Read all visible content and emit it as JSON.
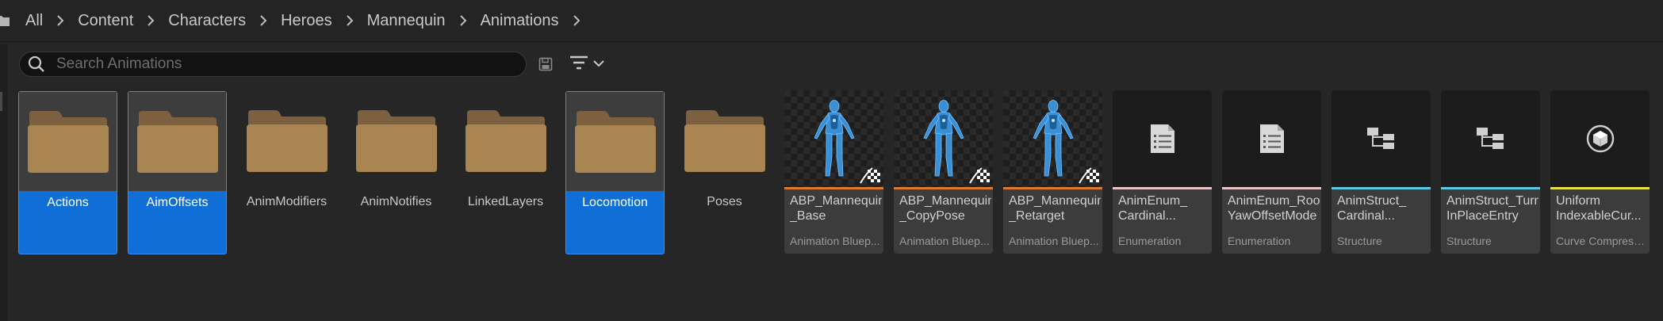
{
  "breadcrumb": {
    "items": [
      "All",
      "Content",
      "Characters",
      "Heroes",
      "Mannequin",
      "Animations"
    ]
  },
  "search": {
    "placeholder": "Search Animations",
    "value": ""
  },
  "folders": [
    {
      "label": "Actions",
      "selected": true
    },
    {
      "label": "AimOffsets",
      "selected": true
    },
    {
      "label": "AnimModifiers",
      "selected": false
    },
    {
      "label": "AnimNotifies",
      "selected": false
    },
    {
      "label": "LinkedLayers",
      "selected": false
    },
    {
      "label": "Locomotion",
      "selected": true
    },
    {
      "label": "Poses",
      "selected": false
    }
  ],
  "assets": [
    {
      "name": "ABP_Mannequin\n_Base",
      "type": "Animation Bluep...",
      "icon": "mannequin-thumbnail",
      "color": "#e07a2b"
    },
    {
      "name": "ABP_Mannequin\n_CopyPose",
      "type": "Animation Bluep...",
      "icon": "mannequin-thumbnail",
      "color": "#e07a2b"
    },
    {
      "name": "ABP_Mannequin\n_Retarget",
      "type": "Animation Bluep...",
      "icon": "mannequin-thumbnail",
      "color": "#e07a2b"
    },
    {
      "name": "AnimEnum_\nCardinal...",
      "type": "Enumeration",
      "icon": "enumeration-icon",
      "color": "#e8c4c8"
    },
    {
      "name": "AnimEnum_Root\nYawOffsetMode",
      "type": "Enumeration",
      "icon": "enumeration-icon",
      "color": "#e8c4c8"
    },
    {
      "name": "AnimStruct_\nCardinal...",
      "type": "Structure",
      "icon": "structure-icon",
      "color": "#5cc8e8"
    },
    {
      "name": "AnimStruct_Turn\nInPlaceEntry",
      "type": "Structure",
      "icon": "structure-icon",
      "color": "#5cc8e8"
    },
    {
      "name": "Uniform\nIndexableCur...",
      "type": "Curve Compressi...",
      "icon": "curve-compression-icon",
      "color": "#e6e04a"
    }
  ],
  "colors": {
    "selection": "#0f6fd6",
    "folder": "#a98552"
  }
}
